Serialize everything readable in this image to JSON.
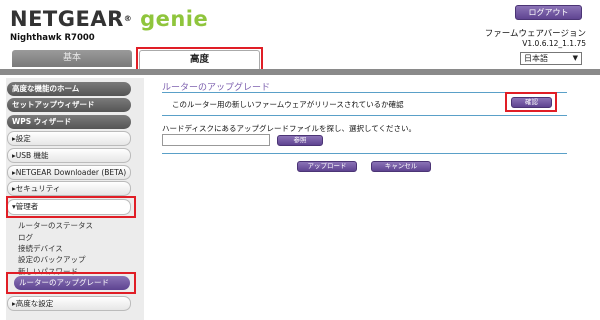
{
  "header": {
    "brand": "NETGEAR",
    "product": "genie",
    "model": "Nighthawk R7000",
    "logout_label": "ログアウト",
    "firmware_title": "ファームウェアバージョン",
    "firmware_version": "V1.0.6.12_1.1.75",
    "language": "日本語"
  },
  "tabs": [
    {
      "label": "基本"
    },
    {
      "label": "高度"
    }
  ],
  "sidebar": {
    "items": [
      {
        "label": "高度な機能のホーム"
      },
      {
        "label": "セットアップウィザード"
      },
      {
        "label": "WPS ウィザード"
      },
      {
        "label": "▸設定"
      },
      {
        "label": "▸USB 機能"
      },
      {
        "label": "▸NETGEAR Downloader (BETA)"
      },
      {
        "label": "▸セキュリティ"
      },
      {
        "label": "▾管理者"
      }
    ],
    "admin_subitems": [
      {
        "label": "ルーターのステータス"
      },
      {
        "label": "ログ"
      },
      {
        "label": "接続デバイス"
      },
      {
        "label": "設定のバックアップ"
      },
      {
        "label": "新しいパスワード"
      },
      {
        "label": "ルーターのアップグレード"
      }
    ],
    "advanced_settings": "▸高度な設定"
  },
  "main": {
    "title": "ルーターのアップグレード",
    "check_text": "このルーター用の新しいファームウェアがリリースされているか確認",
    "check_button": "確認",
    "hd_text": "ハードディスクにあるアップグレードファイルを探し、選択してください。",
    "browse_button": "参照",
    "upload_button": "アップロード",
    "cancel_button": "キャンセル"
  },
  "colors": {
    "accent_purple": "#5f4491",
    "highlight_red": "#e01e26",
    "line_blue": "#5aa0c8",
    "genie_green": "#8fc53c"
  }
}
